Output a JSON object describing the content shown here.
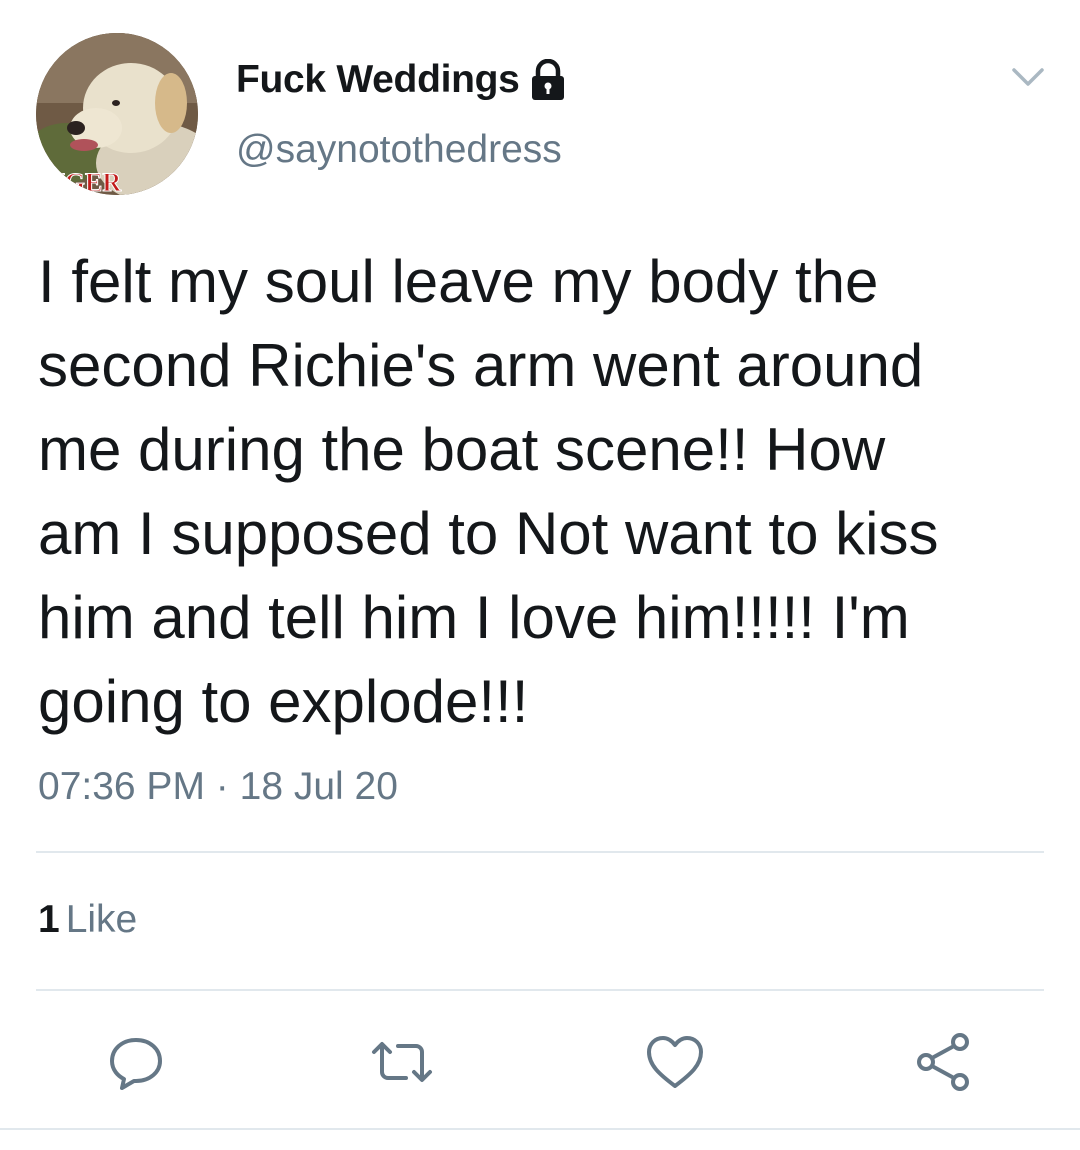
{
  "tweet": {
    "display_name": "Fuck Weddings",
    "handle": "@saynotothedress",
    "text": "I felt my soul leave my body the\nsecond Richie's arm went around\nme during the boat scene!! How\nam I supposed to Not want to kiss\nhim and tell him I love him!!!!! I'm\ngoing to explode!!!",
    "time": "07:36 PM",
    "separator": "·",
    "date": "18 Jul 20",
    "like_count": "1",
    "like_label": "Like",
    "avatar_text": "NGER",
    "icons": {
      "lock": "lock-icon",
      "menu": "chevron-down-icon",
      "reply": "reply-icon",
      "retweet": "retweet-icon",
      "like": "heart-icon",
      "share": "share-icon"
    },
    "colors": {
      "text": "#14171a",
      "secondary": "#657786",
      "divider": "#e1e8ed",
      "icon": "#657786"
    }
  }
}
